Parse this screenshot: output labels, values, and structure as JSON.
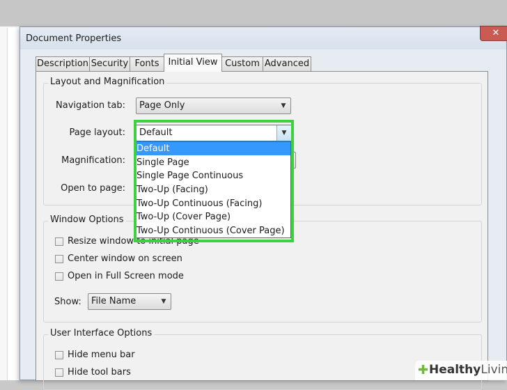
{
  "dialog": {
    "title": "Document Properties",
    "close_glyph": "✕"
  },
  "tabs": [
    {
      "label": "Description"
    },
    {
      "label": "Security"
    },
    {
      "label": "Fonts"
    },
    {
      "label": "Initial View",
      "active": true
    },
    {
      "label": "Custom"
    },
    {
      "label": "Advanced"
    }
  ],
  "layout_magnification": {
    "title": "Layout and Magnification",
    "navigation_tab_label": "Navigation tab:",
    "navigation_tab_value": "Page Only",
    "page_layout_label": "Page layout:",
    "page_layout_value": "Default",
    "magnification_label": "Magnification:",
    "open_to_page_label": "Open to page:"
  },
  "page_layout_options": [
    {
      "label": "Default",
      "selected": true
    },
    {
      "label": "Single Page"
    },
    {
      "label": "Single Page Continuous"
    },
    {
      "label": "Two-Up (Facing)"
    },
    {
      "label": "Two-Up Continuous (Facing)"
    },
    {
      "label": "Two-Up (Cover Page)"
    },
    {
      "label": "Two-Up Continuous (Cover Page)"
    }
  ],
  "window_options": {
    "title": "Window Options",
    "resize_label": "Resize window to initial page",
    "center_label": "Center window on screen",
    "fullscreen_label": "Open in Full Screen mode",
    "show_label": "Show:",
    "show_value": "File Name"
  },
  "ui_options": {
    "title": "User Interface Options",
    "hide_menu_label": "Hide menu bar",
    "hide_toolbars_label": "Hide tool bars"
  },
  "watermark": {
    "healthy": "Healthy",
    "living": "Living"
  },
  "colors": {
    "highlight": "#3fd03f",
    "selection": "#3399ff"
  }
}
